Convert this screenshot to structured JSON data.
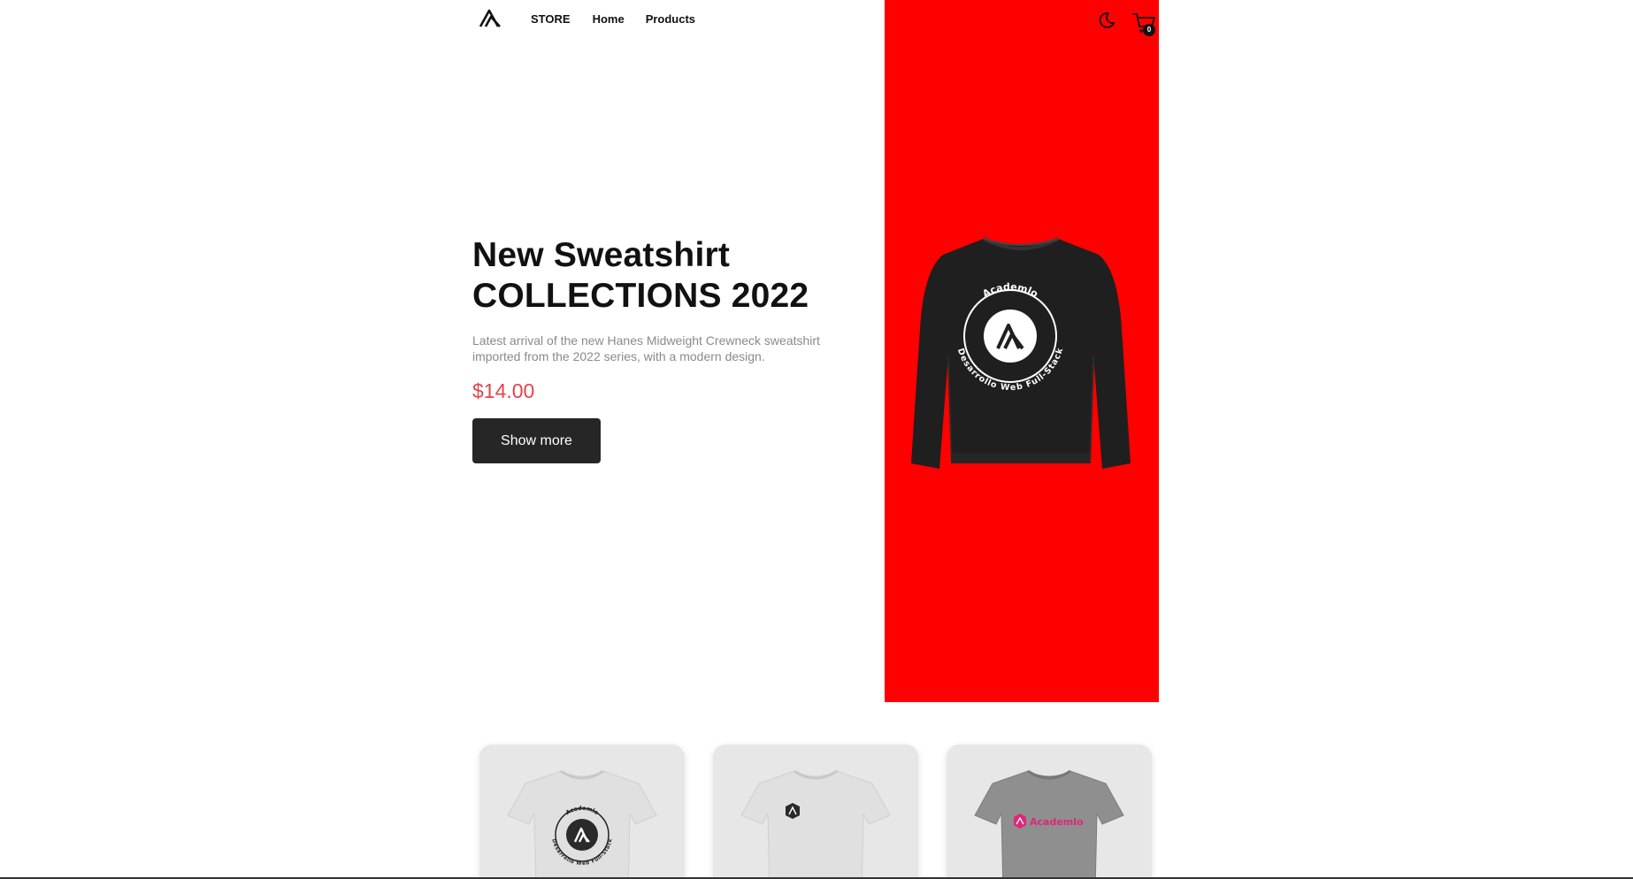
{
  "header": {
    "nav": [
      "STORE",
      "Home",
      "Products"
    ],
    "cart_count": "0"
  },
  "hero": {
    "title_line1": "New Sweatshirt",
    "title_line2": "COLLECTIONS 2022",
    "description": "Latest arrival of the new Hanes Midweight Crewneck sweatshirt imported from the 2022 series, with a modern design.",
    "price": "$14.00",
    "button_label": "Show more",
    "panel_color": "#ff0000",
    "badge_top": "Academlo",
    "badge_bottom": "Desarrollo Web Full-Stack"
  },
  "products": [
    {
      "shirt_color": "#e3e3e3",
      "print": "badge",
      "badge_top": "Academlo",
      "badge_bottom": "Desarrollo Web Full-Stack"
    },
    {
      "shirt_color": "#e3e3e3",
      "print": "small-logo"
    },
    {
      "shirt_color": "#8f8f8f",
      "print": "wordmark",
      "wordmark": "Academlo"
    }
  ],
  "colors": {
    "accent_price": "#e5434a",
    "button_bg": "#262626"
  },
  "icons": [
    "academlo-logo-icon",
    "moon-icon",
    "cart-icon"
  ]
}
